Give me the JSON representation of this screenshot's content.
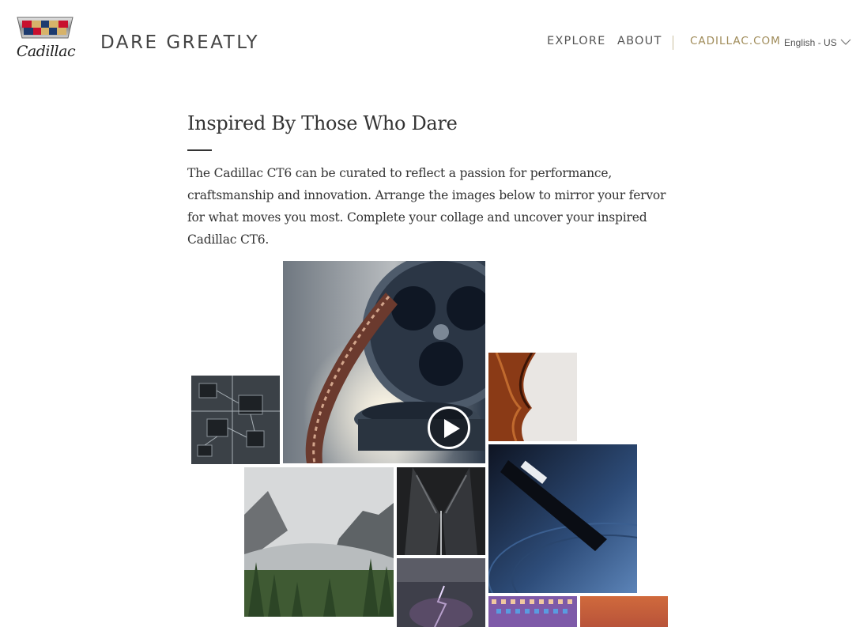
{
  "header": {
    "logo_script": "Cadillac",
    "brand_title": "DARE GREATLY"
  },
  "nav": {
    "explore": "EXPLORE",
    "about": "ABOUT",
    "cadillac_link": "CADILLAC.COM",
    "language": "English - US"
  },
  "intro": {
    "heading": "Inspired By Those Who Dare",
    "body": "The Cadillac CT6 can be curated to reflect a passion for performance, craftsmanship and innovation. Arrange the images below to mirror your fervor for what moves you most. Complete your collage and uncover your inspired Cadillac CT6."
  },
  "collage": {
    "tiles": [
      {
        "name": "film-reel-image",
        "icon": "film-reel"
      },
      {
        "name": "circuit-board-image",
        "icon": "circuit-board"
      },
      {
        "name": "violin-image",
        "icon": "violin"
      },
      {
        "name": "misty-valley-image",
        "icon": "mountain-valley"
      },
      {
        "name": "leather-jacket-image",
        "icon": "leather-jacket"
      },
      {
        "name": "record-player-image",
        "icon": "turntable"
      },
      {
        "name": "lightning-storm-image",
        "icon": "lightning"
      },
      {
        "name": "light-mosaic-image",
        "icon": "mosaic"
      },
      {
        "name": "orange-sunset-image",
        "icon": "sunset"
      }
    ],
    "play_icon": "play-icon"
  },
  "colors": {
    "accent_gold": "#a08c5a",
    "text": "#333333",
    "background": "#ffffff"
  }
}
